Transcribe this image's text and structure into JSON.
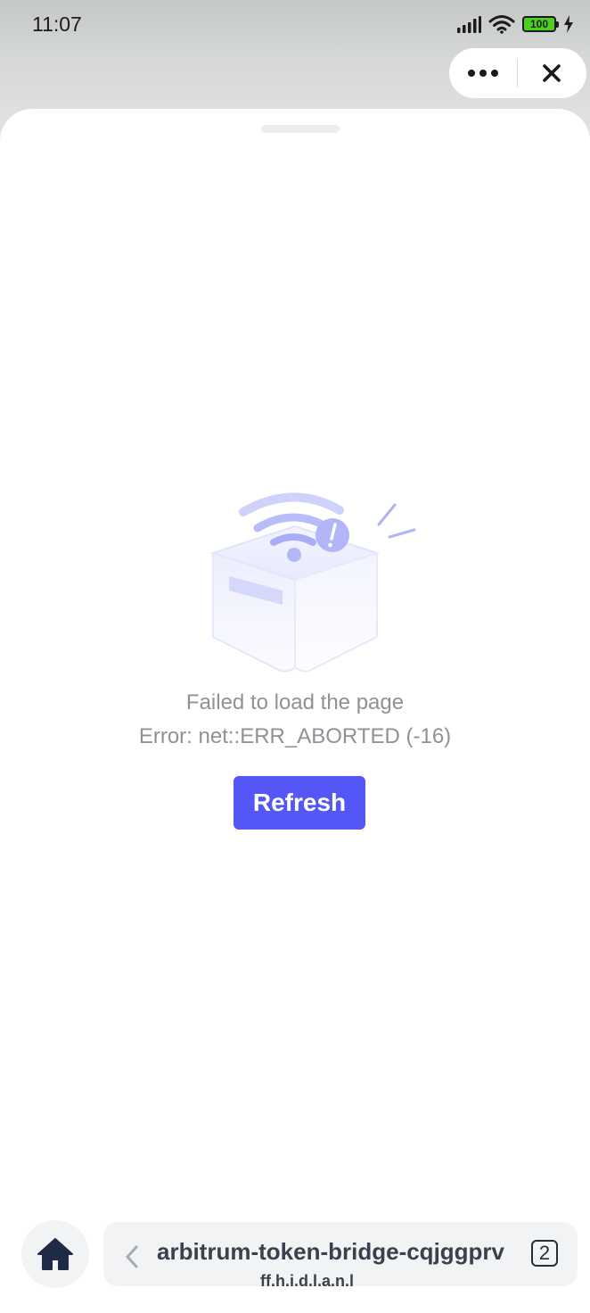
{
  "status_bar": {
    "time": "11:07",
    "battery_level": "100",
    "icons": [
      "signal-icon",
      "wifi-icon",
      "battery-icon",
      "charging-icon"
    ]
  },
  "capsule": {
    "more_icon": "more-dots-icon",
    "close_icon": "close-icon"
  },
  "error": {
    "title": "Failed to load the page",
    "detail": "Error: net::ERR_ABORTED (-16)",
    "refresh_label": "Refresh",
    "illustration_icon": "no-connection-box-icon"
  },
  "bottom_bar": {
    "home_icon": "home-icon",
    "back_icon": "chevron-left-icon",
    "url": "arbitrum-token-bridge-cqjggprv",
    "url_second_line": "ff.h.i.d.l.a.n.l",
    "tab_count": "2"
  },
  "colors": {
    "accent": "#5457f5",
    "error_text": "#8f9196",
    "url_text": "#3c3f4c",
    "battery": "#4cd01f"
  }
}
